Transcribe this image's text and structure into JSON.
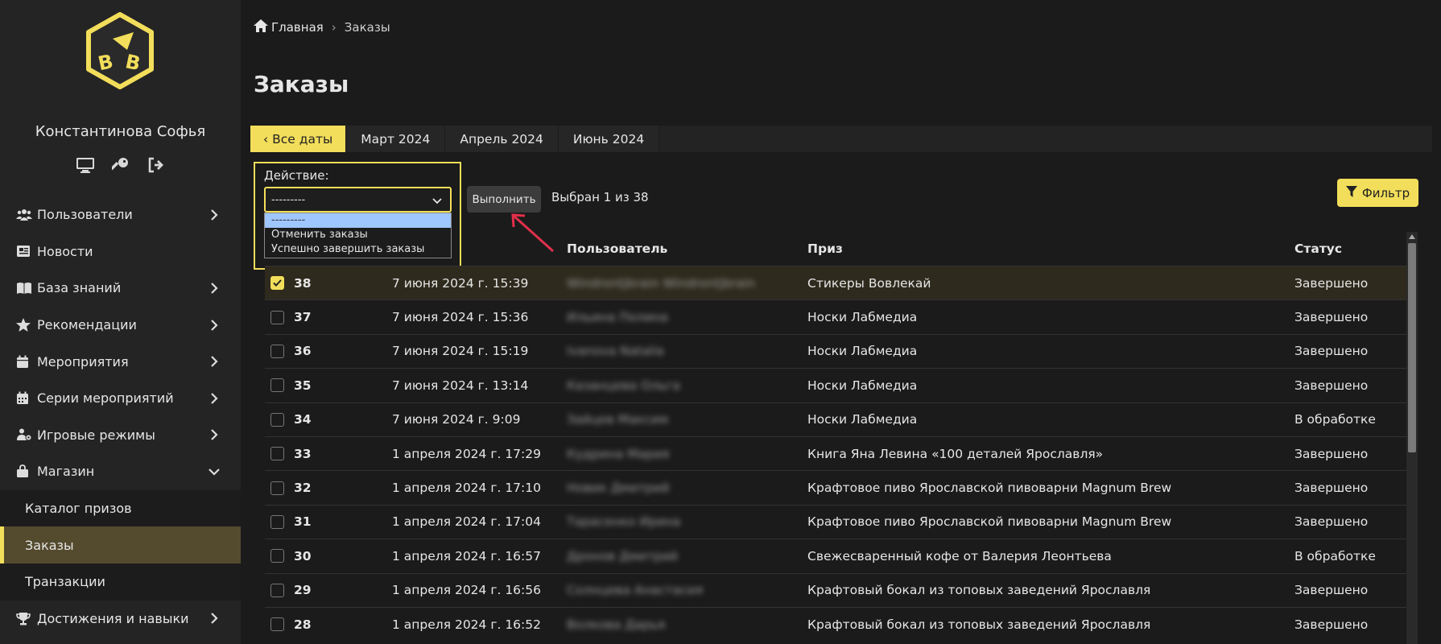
{
  "sidebar": {
    "user_name": "Константинова Софья",
    "user_icons": [
      "monitor-icon",
      "key-icon",
      "logout-icon"
    ],
    "nav_items": [
      {
        "label": "Пользователи",
        "icon": "users-icon",
        "has_chevron": true
      },
      {
        "label": "Новости",
        "icon": "news-icon",
        "has_chevron": false
      },
      {
        "label": "База знаний",
        "icon": "book-icon",
        "has_chevron": true
      },
      {
        "label": "Рекомендации",
        "icon": "star-icon",
        "has_chevron": true
      },
      {
        "label": "Мероприятия",
        "icon": "calendar-icon",
        "has_chevron": true
      },
      {
        "label": "Серии мероприятий",
        "icon": "calendar-grid-icon",
        "has_chevron": true
      },
      {
        "label": "Игровые режимы",
        "icon": "gamepad-icon",
        "has_chevron": true
      },
      {
        "label": "Магазин",
        "icon": "bag-icon",
        "has_chevron": true,
        "expanded": true
      }
    ],
    "sub_items": [
      {
        "label": "Каталог призов",
        "active": false
      },
      {
        "label": "Заказы",
        "active": true
      },
      {
        "label": "Транзакции",
        "active": false
      }
    ],
    "after_items": [
      {
        "label": "Достижения и навыки",
        "icon": "trophy-icon",
        "has_chevron": true
      }
    ]
  },
  "breadcrumb": {
    "home": "Главная",
    "current": "Заказы"
  },
  "page_title": "Заказы",
  "date_tabs": [
    {
      "label": "‹ Все даты",
      "active": true
    },
    {
      "label": "Март 2024",
      "active": false
    },
    {
      "label": "Апрель 2024",
      "active": false
    },
    {
      "label": "Июнь 2024",
      "active": false
    }
  ],
  "action": {
    "label": "Действие:",
    "selected": "---------",
    "options": [
      "---------",
      "Отменить заказы",
      "Успешно завершить заказы"
    ],
    "run_label": "Выполнить",
    "selected_count": "Выбран 1 из 38"
  },
  "filter_label": "Фильтр",
  "colors": {
    "accent": "#f2de5a",
    "sidebar_bg": "#242424",
    "bg": "#1b1b1b",
    "annotation_arrow": "#e0304a"
  },
  "table": {
    "headers": {
      "user": "Пользователь",
      "prize": "Приз",
      "status": "Статус"
    },
    "rows": [
      {
        "id": "38",
        "date": "7 июня 2024 г. 15:39",
        "user": "Windrontjbrain Windrontjbrain",
        "prize": "Стикеры Вовлекай",
        "status": "Завершено",
        "checked": true
      },
      {
        "id": "37",
        "date": "7 июня 2024 г. 15:36",
        "user": "Ильина Полина",
        "prize": "Носки Лабмедиа",
        "status": "Завершено",
        "checked": false
      },
      {
        "id": "36",
        "date": "7 июня 2024 г. 15:19",
        "user": "Ivanova Natalia",
        "prize": "Носки Лабмедиа",
        "status": "Завершено",
        "checked": false
      },
      {
        "id": "35",
        "date": "7 июня 2024 г. 13:14",
        "user": "Казанцева Ольга",
        "prize": "Носки Лабмедиа",
        "status": "Завершено",
        "checked": false
      },
      {
        "id": "34",
        "date": "7 июня 2024 г. 9:09",
        "user": "Зайцев Максим",
        "prize": "Носки Лабмедиа",
        "status": "В обработке",
        "checked": false
      },
      {
        "id": "33",
        "date": "1 апреля 2024 г. 17:29",
        "user": "Кудрина Мария",
        "prize": "Книга Яна Левина «100 деталей Ярославля»",
        "status": "Завершено",
        "checked": false
      },
      {
        "id": "32",
        "date": "1 апреля 2024 г. 17:10",
        "user": "Новик Дмитрий",
        "prize": "Крафтовое пиво Ярославской пивоварни Magnum Brew",
        "status": "Завершено",
        "checked": false
      },
      {
        "id": "31",
        "date": "1 апреля 2024 г. 17:04",
        "user": "Тарасенко Ирина",
        "prize": "Крафтовое пиво Ярославской пивоварни Magnum Brew",
        "status": "Завершено",
        "checked": false
      },
      {
        "id": "30",
        "date": "1 апреля 2024 г. 16:57",
        "user": "Дронов Дмитрий",
        "prize": "Свежесваренный кофе от Валерия Леонтьева",
        "status": "В обработке",
        "checked": false
      },
      {
        "id": "29",
        "date": "1 апреля 2024 г. 16:56",
        "user": "Солнцева Анастасия",
        "prize": "Крафтовый бокал из топовых заведений Ярославля",
        "status": "Завершено",
        "checked": false
      },
      {
        "id": "28",
        "date": "1 апреля 2024 г. 16:52",
        "user": "Волкова Дарья",
        "prize": "Крафтовый бокал из топовых заведений Ярославля",
        "status": "Завершено",
        "checked": false
      }
    ]
  }
}
